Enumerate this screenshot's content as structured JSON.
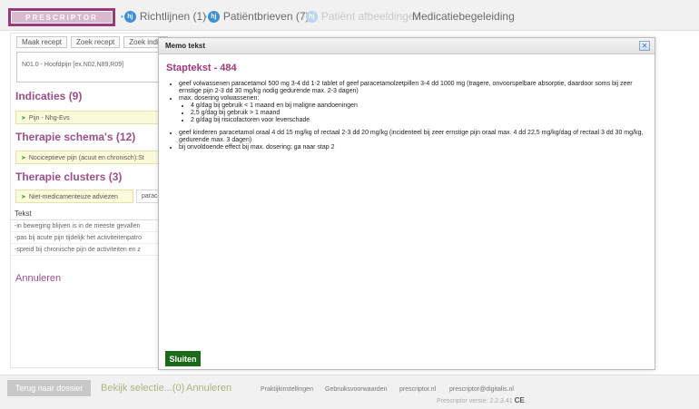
{
  "brand": {
    "logo_text": "PRESCRIPTOR",
    "color": "#9a3a7a"
  },
  "nav": {
    "tabs": [
      {
        "label": "Richtlijnen (1)"
      },
      {
        "label": "Patiëntbrieven (7)"
      },
      {
        "label": "Patiënt afbeeldingen"
      },
      {
        "label": "Medicatiebegeleiding"
      }
    ],
    "badge_text": "hj"
  },
  "background": {
    "buttons": [
      "Maak recept",
      "Zoek recept",
      "Zoek indic"
    ],
    "code_text": "N01.0 - Hoofdpijn [ex.N02,N89,R09]",
    "indicaties_heading": "Indicaties (9)",
    "indicaties_item": "Pijn - Nhg-Evs",
    "therapie_heading": "Therapie schema's (12)",
    "therapie_item": "Nociceptieve pijn (acuut en chronisch):St",
    "clusters_heading": "Therapie clusters (3)",
    "cluster_chips": [
      "Niet-medicamenteuze adviezen",
      "parac"
    ],
    "table_header": "Tekst",
    "table_rows": [
      "-in beweging blijven is in de meeste gevallen",
      "-pas bij acute pijn tijdelijk het activiteitenpatro",
      "-spreid bij chronische pijn de activiteiten en z"
    ],
    "annuleren": "Annuleren"
  },
  "modal": {
    "title": "Memo tekst",
    "heading": "Staptekst - 484",
    "bullets": {
      "b1": "geef volwassenen paracetamol 500 mg 3-4 dd 1-2 tablet of geef paracetamolzetpillen 3-4 dd 1000 mg (tragere, onvoorspelbare absorptie, daardoor soms bij zeer ernstige pijn 2-3 dd 30 mg/kg nodig gedurende max. 2-3 dagen)",
      "b2": "max. dosering volwassenen:",
      "b2_sub": [
        "4 g/dag bij gebruik < 1 maand en bij maligne aandoeningen",
        "2,5 g/dag bij gebruik > 1 maand",
        "2 g/dag bij risicofactoren voor leverschade"
      ],
      "b3": "geef kinderen paracetamol oraal 4 dd 15 mg/kg of rectaal 2-3 dd 20 mg/kg (incidenteel bij zeer ernstige pijn oraal max. 4 dd 22,5 mg/kg/dag of rectaal 3 dd 30 mg/kg, gedurende max. 3 dagen)",
      "b4": "bij onvoldoende effect bij max. dosering: ga naar stap 2"
    },
    "close_button": "Sluiten",
    "close_icon": "close-icon"
  },
  "footer": {
    "terug": "Terug naar dossier",
    "bekijk": "Bekijk selectie...(0)",
    "annuleren": "Annuleren",
    "links": [
      "Praktijkinstellingen",
      "Gebruiksvoorwaarden",
      "prescriptor.nl",
      "prescriptor@digitalis.nl"
    ],
    "version": "Prescriptor versie: 2.2.3.41",
    "ce_mark": "CE"
  }
}
